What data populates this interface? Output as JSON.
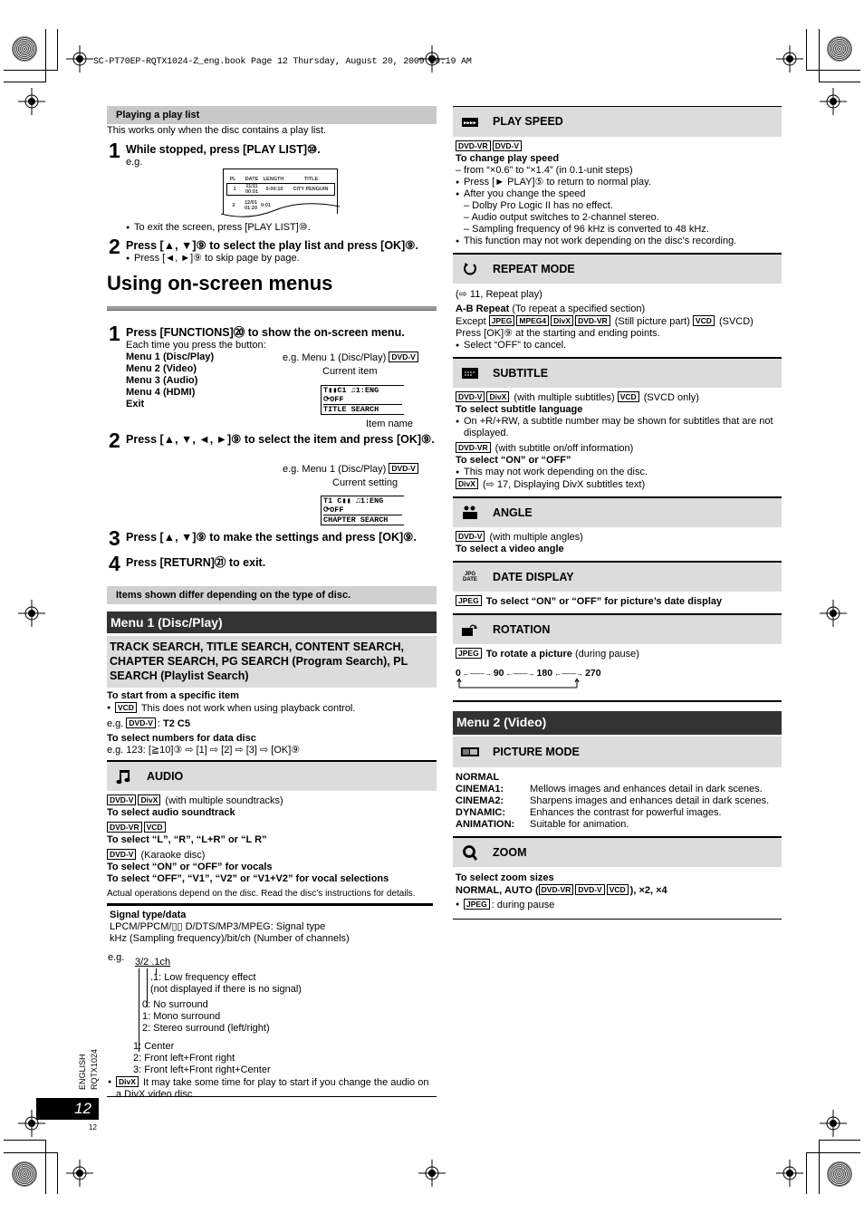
{
  "header": {
    "book_line": "SC-PT70EP-RQTX1024-Z_eng.book  Page 12  Thursday, August 20, 2009  10:19 AM"
  },
  "playlist": {
    "bar_title": "Playing a play list",
    "intro": "This works only when the disc contains a play list.",
    "step1": {
      "num": "1",
      "title": "While stopped, press [PLAY LIST]⑩.",
      "eg": "e.g."
    },
    "table": {
      "headers": [
        "PL",
        "DATE",
        "LENGTH",
        "TITLE"
      ],
      "rows": [
        [
          "1",
          "11/11 00:01",
          "0:00:10",
          "CITY PENGUIN"
        ],
        [
          "2",
          "12/01 01:20",
          "0:01",
          ""
        ]
      ]
    },
    "exit_note": "To exit the screen, press [PLAY LIST]⑩.",
    "step2": {
      "num": "2",
      "title": "Press [▲, ▼]⑨ to select the play list and press [OK]⑨.",
      "bullet": "Press [◄, ►]⑨ to skip page by page."
    }
  },
  "onscreen": {
    "heading": "Using on-screen menus",
    "step1": {
      "num": "1",
      "title": "Press [FUNCTIONS]⑳ to show the on-screen menu.",
      "sub": "Each time you press the button:",
      "menus": [
        "Menu 1 (Disc/Play)",
        "Menu 2 (Video)",
        "Menu 3 (Audio)",
        "Menu 4 (HDMI)",
        "Exit"
      ],
      "eg": "e.g. Menu 1 (Disc/Play)",
      "eg_tag": "DVD-V",
      "current_item_label": "Current item",
      "item_name_label": "Item name",
      "osd_row1": "T▮▮C1   ♫1:ENG",
      "osd_row2": "⟳OFF",
      "osd_row3": "TITLE SEARCH"
    },
    "step2": {
      "num": "2",
      "title": "Press [▲, ▼, ◄, ►]⑨ to select the item and press [OK]⑨.",
      "eg": "e.g. Menu 1 (Disc/Play)",
      "eg_tag": "DVD-V",
      "current_setting_label": "Current setting",
      "osd_row1": "T1 C▮▮  ♫1:ENG",
      "osd_row2": "⟳OFF",
      "osd_row3": "CHAPTER SEARCH"
    },
    "step3": {
      "num": "3",
      "title": "Press [▲, ▼]⑨ to make the settings and press [OK]⑨."
    },
    "step4": {
      "num": "4",
      "title": "Press [RETURN]㉑ to exit."
    },
    "differ_note": "Items shown differ depending on the type of disc."
  },
  "menu1": {
    "title": "Menu 1 (Disc/Play)",
    "search_items": "TRACK SEARCH, TITLE SEARCH, CONTENT SEARCH, CHAPTER SEARCH, PG SEARCH (Program Search), PL SEARCH (Playlist Search)",
    "specific_title": "To start from a specific item",
    "vcd_tag": "VCD",
    "vcd_note": "This does not work when using playback control.",
    "eg_prefix": "e.g.",
    "eg_tag": "DVD-V",
    "eg_value": "T2 C5",
    "numbers_title": "To select numbers for data disc",
    "numbers_eg": "e.g. 123: [≧10]③ ⇨ [1] ⇨ [2] ⇨ [3] ⇨ [OK]⑨",
    "audio": {
      "label": "AUDIO",
      "line1_tags": [
        "DVD-V",
        "DivX"
      ],
      "line1_text": "(with multiple soundtracks)",
      "line1_bold": "To select audio soundtrack",
      "line2_tags": [
        "DVD-VR",
        "VCD"
      ],
      "line2_bold": "To select “L”, “R”, “L+R” or “L R”",
      "line3_tag": "DVD-V",
      "line3_text": "(Karaoke disc)",
      "line3_bold_a": "To select “ON” or “OFF” for vocals",
      "line3_bold_b": "To select “OFF”, “V1”, “V2” or “V1+V2” for vocal selections",
      "note": "Actual operations depend on the disc. Read the disc’s instructions for details."
    },
    "signal": {
      "title": "Signal type/data",
      "line1": "LPCM/PPCM/▯▯ D/DTS/MP3/MPEG:  Signal type",
      "line2": "kHz (Sampling frequency)/bit/ch (Number of channels)",
      "eg": "e.g.",
      "example": "3/2 .1ch",
      "lfe_a": ".1:  Low frequency effect",
      "lfe_b": "(not displayed if there is no signal)",
      "surround": [
        "0:  No surround",
        "1:  Mono surround",
        "2:  Stereo surround (left/right)"
      ],
      "front": [
        "1:  Center",
        "2:  Front left+Front right",
        "3:  Front left+Front right+Center"
      ],
      "divx_tag": "DivX",
      "divx_note": "It may take some time for play to start if you change the audio on a DivX video disc."
    }
  },
  "right": {
    "play_speed": {
      "label": "PLAY SPEED",
      "tags": [
        "DVD-VR",
        "DVD-V"
      ],
      "bold": "To change play speed",
      "range": "– from “×0.6” to “×1.4” (in 0.1-unit steps)",
      "b1": "Press [► PLAY]⑤ to return to normal play.",
      "b2": "After you change the speed",
      "d1": "– Dolby Pro Logic II has no effect.",
      "d2": "– Audio output switches to 2-channel stereo.",
      "d3": "– Sampling frequency of 96 kHz is converted to 48 kHz.",
      "b3": "This function may not work depending on the disc’s recording."
    },
    "repeat": {
      "label": "REPEAT MODE",
      "ref": "(⇨ 11, Repeat play)",
      "ab_bold": "A-B Repeat",
      "ab_text": "(To repeat a specified section)",
      "except": "Except",
      "tags": [
        "JPEG",
        "MPEG4",
        "DivX",
        "DVD-VR"
      ],
      "still": "(Still picture part)",
      "vcd_tag": "VCD",
      "svcd": "(SVCD)",
      "press": "Press [OK]⑨ at the starting and ending points.",
      "cancel": "Select “OFF” to cancel."
    },
    "subtitle": {
      "label": "SUBTITLE",
      "tags1": [
        "DVD-V",
        "DivX"
      ],
      "text1": "(with multiple subtitles)",
      "vcd_tag": "VCD",
      "svcd": "(SVCD only)",
      "bold1": "To select subtitle language",
      "b1": "On +R/+RW, a subtitle number may be shown for subtitles that are not displayed.",
      "tag2": "DVD-VR",
      "text2": "(with subtitle on/off information)",
      "bold2": "To select “ON” or “OFF”",
      "b2": "This may not work depending on the disc.",
      "tag3": "DivX",
      "text3": "(⇨ 17, Displaying DivX subtitles text)"
    },
    "angle": {
      "label": "ANGLE",
      "tag": "DVD-V",
      "text": "(with multiple angles)",
      "bold": "To select a video angle"
    },
    "date_display": {
      "label": "DATE DISPLAY",
      "icon_top": "JPG",
      "icon_bottom": "DATE",
      "tag": "JPEG",
      "bold": "To select “ON” or “OFF” for picture’s date display"
    },
    "rotation": {
      "label": "ROTATION",
      "tag": "JPEG",
      "bold": "To rotate a picture",
      "text": "(during pause)",
      "cycle": [
        "0",
        "90",
        "180",
        "270"
      ]
    },
    "menu2": {
      "title": "Menu 2 (Video)",
      "picture_mode": {
        "label": "PICTURE MODE",
        "modes": [
          {
            "name": "NORMAL",
            "desc": ""
          },
          {
            "name": "CINEMA1:",
            "desc": "Mellows images and enhances detail in dark scenes."
          },
          {
            "name": "CINEMA2:",
            "desc": "Sharpens images and enhances detail in dark scenes."
          },
          {
            "name": "DYNAMIC:",
            "desc": "Enhances the contrast for powerful images."
          },
          {
            "name": "ANIMATION:",
            "desc": "Suitable for animation."
          }
        ]
      },
      "zoom": {
        "label": "ZOOM",
        "bold": "To select zoom sizes",
        "line_prefix": "NORMAL, AUTO (",
        "tags": [
          "DVD-VR",
          "DVD-V",
          "VCD"
        ],
        "line_suffix": "), ×2, ×4",
        "jpeg_tag": "JPEG",
        "jpeg_text": ": during pause"
      }
    }
  },
  "footer": {
    "language": "ENGLISH",
    "model": "RQTX1024",
    "page_number": "12",
    "page_small": "12"
  }
}
